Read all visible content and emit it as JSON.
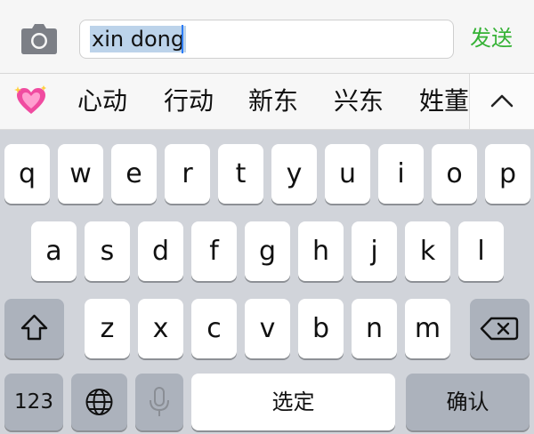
{
  "topbar": {
    "camera_icon": "camera-icon",
    "input_value": "xin dong",
    "send_label": "发送"
  },
  "candidates": {
    "emoji_icon": "sparkling-heart-icon",
    "items": [
      "心动",
      "行动",
      "新东",
      "兴东",
      "姓董"
    ],
    "expand_icon": "chevron-up-icon"
  },
  "keyboard": {
    "row1": [
      "q",
      "w",
      "e",
      "r",
      "t",
      "y",
      "u",
      "i",
      "o",
      "p"
    ],
    "row2": [
      "a",
      "s",
      "d",
      "f",
      "g",
      "h",
      "j",
      "k",
      "l"
    ],
    "row3": [
      "z",
      "x",
      "c",
      "v",
      "b",
      "n",
      "m"
    ],
    "shift_icon": "shift-arrow-icon",
    "delete_icon": "backspace-icon",
    "numbers_label": "123",
    "globe_icon": "globe-icon",
    "mic_icon": "microphone-icon",
    "space_label": "选定",
    "confirm_label": "确认"
  },
  "colors": {
    "send": "#35b235",
    "selection": "#bcd3ea",
    "caret": "#2d7cf6",
    "keyboard_bg": "#d1d4da",
    "function_key": "#acb2bc"
  }
}
